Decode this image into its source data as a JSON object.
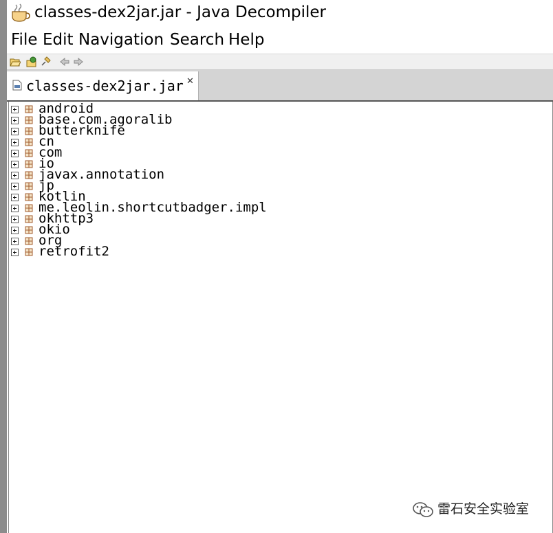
{
  "window": {
    "title": "classes-dex2jar.jar - Java Decompiler"
  },
  "menu": {
    "items": [
      "File",
      "Edit",
      "Navigation",
      "Search",
      "Help"
    ]
  },
  "toolbar": {
    "icons": [
      "open-file-icon",
      "open-type-icon",
      "pin-icon",
      "back-arrow-icon",
      "forward-arrow-icon"
    ]
  },
  "tab": {
    "label": "classes-dex2jar.jar",
    "close_glyph": "✕"
  },
  "tree": {
    "items": [
      "android",
      "base.com.agoralib",
      "butterknife",
      "cn",
      "com",
      "io",
      "javax.annotation",
      "jp",
      "kotlin",
      "me.leolin.shortcutbadger.impl",
      "okhttp3",
      "okio",
      "org",
      "retrofit2"
    ]
  },
  "watermark": {
    "text": "雷石安全实验室"
  },
  "colors": {
    "package_icon": "#a05a2c",
    "tab_strip": "#d4d4d4",
    "toolbar_bg": "#f0f0f0"
  }
}
